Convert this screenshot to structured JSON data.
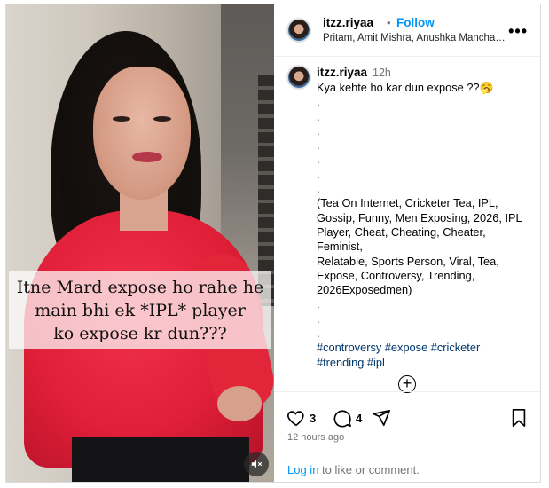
{
  "media": {
    "overlay_lines": [
      "Itne Mard expose ho rahe he",
      "main bhi ek *IPL* player",
      "ko expose kr dun???"
    ],
    "mute_icon": "speaker-muted-icon"
  },
  "header": {
    "username": "itzz.riyaa",
    "dot": "•",
    "follow_label": "Follow",
    "collaborators": "Pritam, Amit Mishra, Anushka Mancha…",
    "more_icon": "more-horizontal-icon"
  },
  "caption": {
    "username": "itzz.riyaa",
    "time": "12h",
    "first_line": "Kya kehte ho kar dun expose ??🥱",
    "dots": [
      ".",
      ".",
      ".",
      ".",
      ".",
      ".",
      "."
    ],
    "tags_lines": [
      "(Tea On Internet, Cricketer Tea, IPL,",
      "Gossip, Funny, Men Exposing, 2026, IPL",
      "Player, Cheat, Cheating, Cheater, Feminist,",
      "Relatable, Sports Person, Viral, Tea,",
      "Expose, Controversy, Trending,",
      "2026Exposedmen)"
    ],
    "dots2": [
      ".",
      ".",
      "."
    ],
    "hashtags_line1": "#controversy #expose #cricketer",
    "hashtags_line2": "#trending #ipl"
  },
  "actions": {
    "like_count": "3",
    "comment_count": "4",
    "posted_ago": "12 hours ago",
    "login_link": "Log in",
    "login_rest": " to like or comment."
  },
  "colors": {
    "link_blue": "#0095f6",
    "hashtag_blue": "#00376b",
    "shirt_red": "#e01f38"
  }
}
